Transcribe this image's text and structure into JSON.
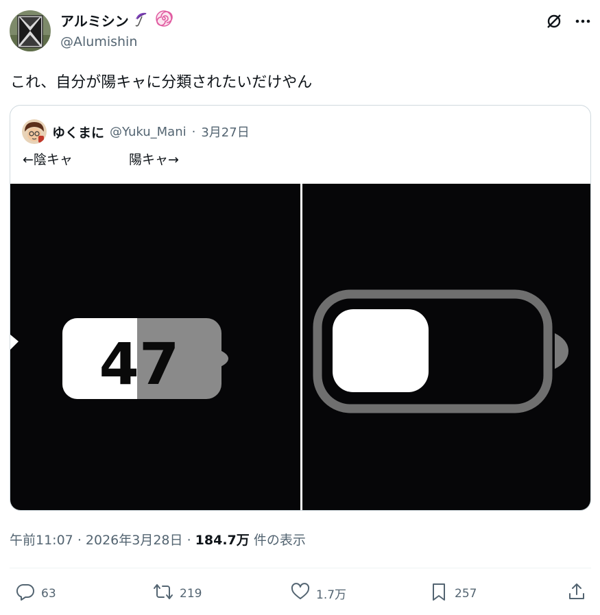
{
  "author": {
    "display_name": "アルミシン",
    "handle": "@Alumishin"
  },
  "tweet": {
    "text": "これ、自分が陽キャに分類されたいだけやん"
  },
  "quote": {
    "display_name": "ゆくまに",
    "handle": "@Yuku_Mani",
    "separator": "·",
    "date": "3月27日",
    "text_left": "←陰キャ",
    "text_right": "陽キャ→",
    "battery_number": "47",
    "battery_level_left": 0.47
  },
  "meta": {
    "time": "午前11:07",
    "sep1": "·",
    "date": "2026年3月28日",
    "sep2": "·",
    "views": "184.7万",
    "views_suffix": "件の表示"
  },
  "actions": {
    "replies": "63",
    "retweets": "219",
    "likes": "1.7万",
    "bookmarks": "257"
  },
  "colors": {
    "text_primary": "#0f1419",
    "text_secondary": "#536471",
    "border": "#cfd9de",
    "image_bg": "#060608",
    "battery_grey": "#8a8a8a",
    "umbrella_purple": "#7b3fb5",
    "swirl_pink": "#e05aa0"
  },
  "icons": [
    "grok-icon",
    "more-icon",
    "reply-icon",
    "retweet-icon",
    "like-icon",
    "bookmark-icon",
    "share-icon",
    "umbrella-emoji-icon",
    "swirl-emoji-icon"
  ]
}
